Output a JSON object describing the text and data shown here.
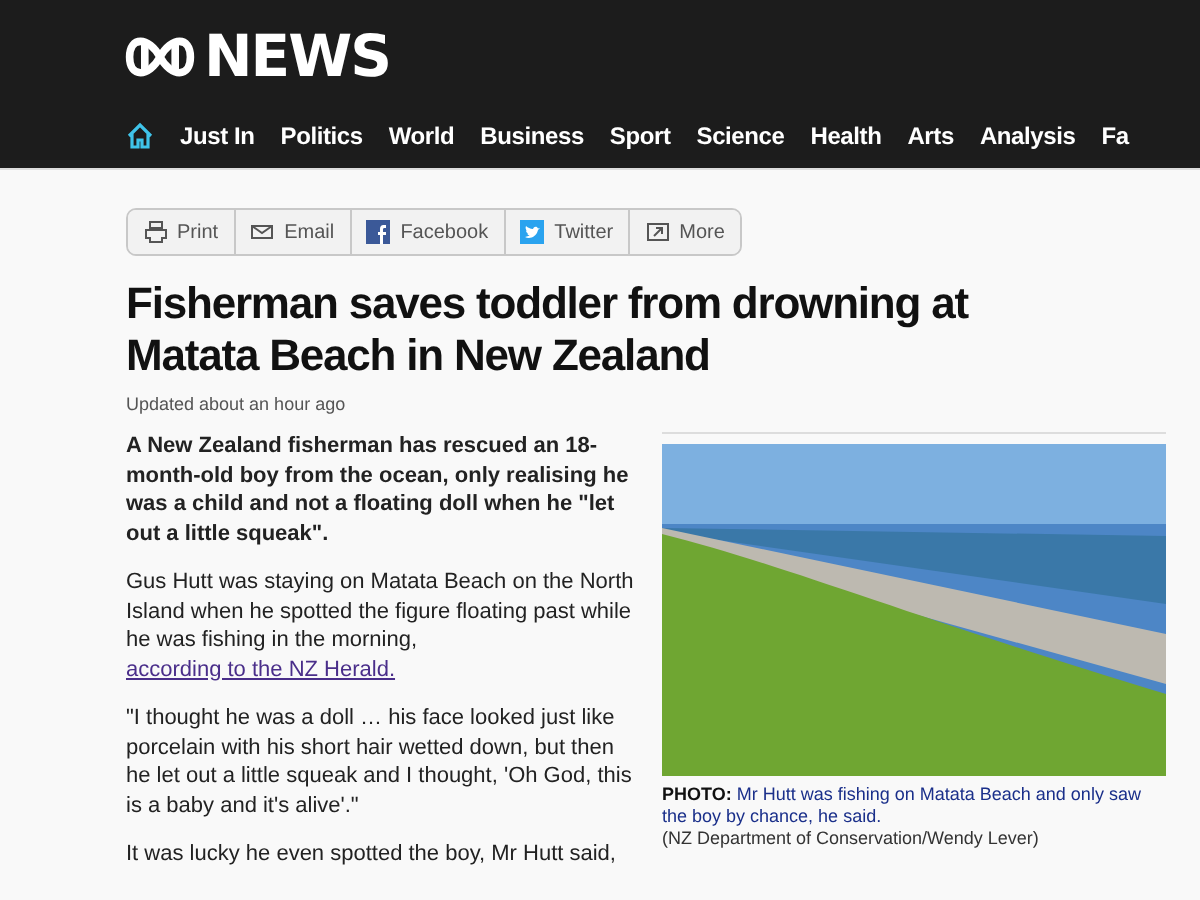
{
  "header": {
    "logo_text": "NEWS"
  },
  "nav": {
    "items": [
      "Just In",
      "Politics",
      "World",
      "Business",
      "Sport",
      "Science",
      "Health",
      "Arts",
      "Analysis",
      "Fa"
    ]
  },
  "share": [
    {
      "kind": "print",
      "label": "Print"
    },
    {
      "kind": "email",
      "label": "Email"
    },
    {
      "kind": "facebook",
      "label": "Facebook"
    },
    {
      "kind": "twitter",
      "label": "Twitter"
    },
    {
      "kind": "more",
      "label": "More"
    }
  ],
  "article": {
    "headline": "Fisherman saves toddler from drowning at Matata Beach in New Zealand",
    "updated": "Updated about an hour ago",
    "paragraphs": [
      {
        "kind": "lead",
        "text": "A New Zealand fisherman has rescued an 18-month-old boy from the ocean, only realising he was a child and not a floating doll when he \"let out a little squeak\"."
      },
      {
        "kind": "body",
        "text": "Gus Hutt was staying on Matata Beach on the North Island when he spotted the figure floating past while he was fishing in the morning, ",
        "link": "according to the NZ Herald."
      },
      {
        "kind": "body",
        "text": "\"I thought he was a doll … his face looked just like porcelain with his short hair wetted down, but then he let out a little squeak and I thought, 'Oh God, this is a baby and it's alive'.\""
      },
      {
        "kind": "body",
        "text": "It was lucky he even spotted the boy, Mr Hutt said,"
      }
    ],
    "photo": {
      "caption": "**PHOTO:** Mr Hutt was fishing on Matata Beach and only saw the boy by chance, he said.",
      "credit": "(NZ Department of Conservation/Wendy Lever)"
    }
  }
}
